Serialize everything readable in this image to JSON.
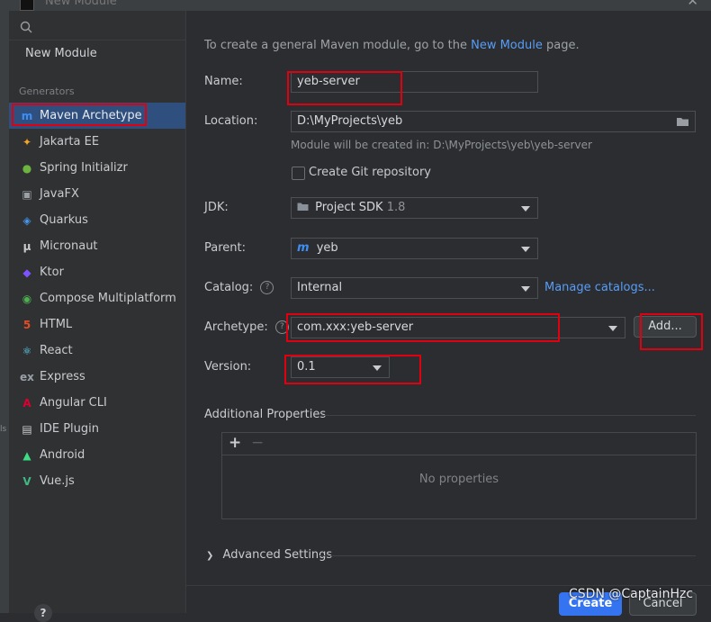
{
  "window": {
    "title": "New Module"
  },
  "sidebar": {
    "new_module": "New Module",
    "generators_header": "Generators",
    "items": [
      {
        "label": "Maven Archetype",
        "icon": "maven-icon",
        "glyph": "m",
        "color": "#3d8ff5"
      },
      {
        "label": "Jakarta EE",
        "icon": "jakarta-icon",
        "glyph": "✦",
        "color": "#f5a623"
      },
      {
        "label": "Spring Initializr",
        "icon": "spring-icon",
        "glyph": "●",
        "color": "#6db33f"
      },
      {
        "label": "JavaFX",
        "icon": "javafx-icon",
        "glyph": "▣",
        "color": "#9aa0a6"
      },
      {
        "label": "Quarkus",
        "icon": "quarkus-icon",
        "glyph": "◈",
        "color": "#4695eb"
      },
      {
        "label": "Micronaut",
        "icon": "micronaut-icon",
        "glyph": "μ",
        "color": "#c9cbce"
      },
      {
        "label": "Ktor",
        "icon": "ktor-icon",
        "glyph": "◆",
        "color": "#7f52ff"
      },
      {
        "label": "Compose Multiplatform",
        "icon": "compose-icon",
        "glyph": "◉",
        "color": "#4caf50"
      },
      {
        "label": "HTML",
        "icon": "html-icon",
        "glyph": "5",
        "color": "#e44d26"
      },
      {
        "label": "React",
        "icon": "react-icon",
        "glyph": "⚛",
        "color": "#61dafb"
      },
      {
        "label": "Express",
        "icon": "express-icon",
        "glyph": "ex",
        "color": "#9aa0a6"
      },
      {
        "label": "Angular CLI",
        "icon": "angular-icon",
        "glyph": "A",
        "color": "#dd0031"
      },
      {
        "label": "IDE Plugin",
        "icon": "ide-plugin-icon",
        "glyph": "▤",
        "color": "#c9cbce"
      },
      {
        "label": "Android",
        "icon": "android-icon",
        "glyph": "▲",
        "color": "#3ddc84"
      },
      {
        "label": "Vue.js",
        "icon": "vue-icon",
        "glyph": "V",
        "color": "#41b883"
      }
    ],
    "help": "?"
  },
  "form": {
    "intro_prefix": "To create a general Maven module, go to the",
    "intro_link": "New Module",
    "intro_suffix": "page.",
    "name_label": "Name:",
    "name_value": "yeb-server",
    "location_label": "Location:",
    "location_value": "D:\\MyProjects\\yeb",
    "location_hint": "Module will be created in: D:\\MyProjects\\yeb\\yeb-server",
    "git_label": "Create Git repository",
    "jdk_label": "JDK:",
    "jdk_value": "Project SDK",
    "jdk_version": "1.8",
    "parent_label": "Parent:",
    "parent_value": "yeb",
    "catalog_label": "Catalog:",
    "catalog_value": "Internal",
    "manage_catalogs": "Manage catalogs...",
    "archetype_label": "Archetype:",
    "archetype_value": "com.xxx:yeb-server",
    "add_button": "Add...",
    "version_label": "Version:",
    "version_value": "0.1",
    "additional_props": "Additional Properties",
    "no_properties": "No properties",
    "advanced_settings": "Advanced Settings"
  },
  "footer": {
    "create": "Create",
    "cancel": "Cancel"
  },
  "watermark": "CSDN @CaptainHzc"
}
